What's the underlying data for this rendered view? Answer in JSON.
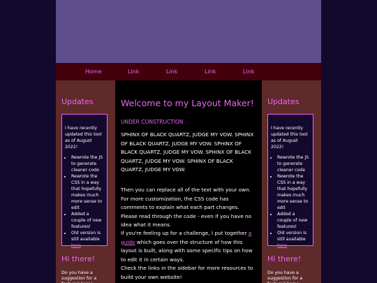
{
  "nav": {
    "items": [
      "Home",
      "Link",
      "Link",
      "Link",
      "Link"
    ]
  },
  "sidebar_left": {
    "title": "Updates",
    "box_intro": "I have recently updated this tool as of August 2022!",
    "box_items": [
      "Rewrote the JS to generate cleaner code",
      "Rewrote the CSS in a way that hopefully makes much more sense to edit",
      "Added a couple of new features!"
    ],
    "old_version_prefix": "Old version is still available",
    "old_version_link": "here",
    "title2": "Hi there!",
    "text2": "Do you have a suggestion for a feature? Some"
  },
  "sidebar_right": {
    "title": "Updates",
    "box_intro": "I have recently updated this tool as of August 2022!",
    "box_items": [
      "Rewrote the JS to generate cleaner code",
      "Rewrote the CSS in a way that hopefully makes much more sense to edit",
      "Added a couple of new features!"
    ],
    "old_version_prefix": "Old version is still available",
    "old_version_link": "here",
    "title2": "Hi there!",
    "text2": "Do you have a suggestion for a feature? Some"
  },
  "main": {
    "title": "Welcome to my Layout Maker!",
    "status": "UNDER CONSTRUCTION",
    "para1": "SPHINX OF BLACK QUARTZ, JUDGE MY VOW. SPHINX OF BLACK QUARTZ, JUDGE MY VOW. SPHINX OF BLACK QUARTZ, JUDGE MY VOW. SPHINX OF BLACK QUARTZ, JUDGE MY VOW. SPHINX OF BLACK QUARTZ, JUDGE MY VOW.",
    "para2": "Then you can replace all of the text with your own. For more customization, the CSS code has comments to explain what each part changes. Please read through the code - even if you have no idea what it means.",
    "para3_before": "If you're feeling up for a challenge, I put together",
    "para3_link": "a guide",
    "para3_after": "which goes over the structure of how this layout is built, along with some specific tips on how to edit it in certain ways.",
    "para4": "Check the links in the sidebar for more resources to build your own website!"
  }
}
